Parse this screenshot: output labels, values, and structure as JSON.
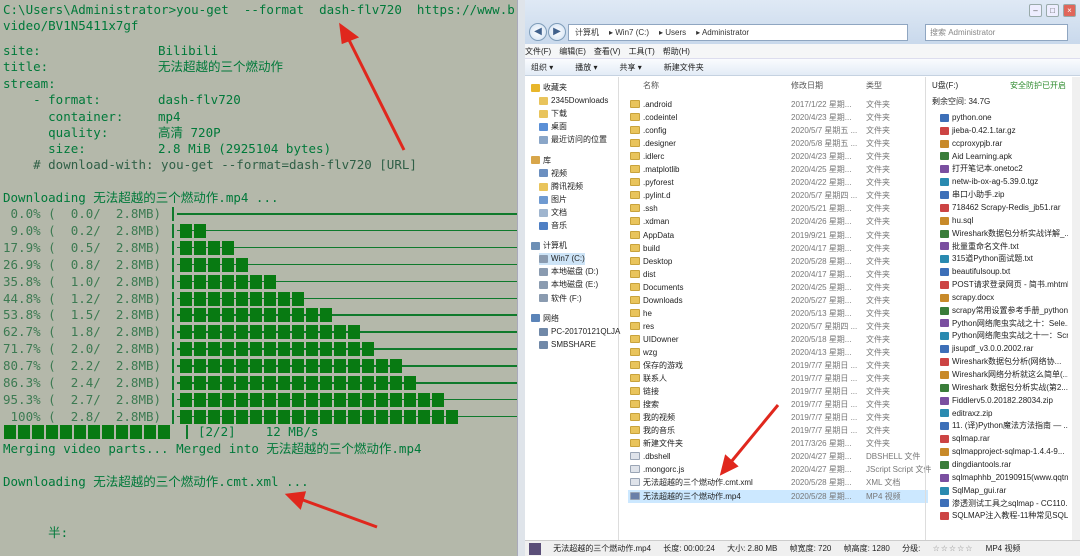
{
  "terminal": {
    "command_line_1": "C:\\Users\\Administrator>you-get  --format  dash-flv720  https://www.b",
    "command_line_2": "video/BV1N5411x7gf",
    "info": [
      {
        "label": "site:",
        "value": "Bilibili"
      },
      {
        "label": "title:",
        "value": "无法超越的三个燃动作"
      },
      {
        "label": "stream:",
        "value": ""
      }
    ],
    "stream": [
      {
        "label": "    - format:",
        "value": "dash-flv720"
      },
      {
        "label": "      container:",
        "value": "mp4"
      },
      {
        "label": "      quality:",
        "value": "高清 720P"
      },
      {
        "label": "      size:",
        "value": "2.8 MiB (2925104 bytes)"
      }
    ],
    "download_with": "    # download-with: you-get --format=dash-flv720 [URL]",
    "downloading_video": "Downloading 无法超越的三个燃动作.mp4 ...",
    "progress": [
      {
        "label": " 0.0% (  0.0/  2.8MB)",
        "fraction": 0.0
      },
      {
        "label": " 9.0% (  0.2/  2.8MB)",
        "fraction": 0.09
      },
      {
        "label": "17.9% (  0.5/  2.8MB)",
        "fraction": 0.179
      },
      {
        "label": "26.9% (  0.8/  2.8MB)",
        "fraction": 0.269
      },
      {
        "label": "35.8% (  1.0/  2.8MB)",
        "fraction": 0.358
      },
      {
        "label": "44.8% (  1.2/  2.8MB)",
        "fraction": 0.448
      },
      {
        "label": "53.8% (  1.5/  2.8MB)",
        "fraction": 0.538
      },
      {
        "label": "62.7% (  1.8/  2.8MB)",
        "fraction": 0.627
      },
      {
        "label": "71.7% (  2.0/  2.8MB)",
        "fraction": 0.717
      },
      {
        "label": "80.7% (  2.2/  2.8MB)",
        "fraction": 0.807
      },
      {
        "label": "86.3% (  2.4/  2.8MB)",
        "fraction": 0.863
      },
      {
        "label": "95.3% (  2.7/  2.8MB)",
        "fraction": 0.953
      },
      {
        "label": " 100% (  2.8/  2.8MB)",
        "fraction": 1.0
      }
    ],
    "final_bar_label": "[2/2]    12 MB/s",
    "merging": "Merging video parts... Merged into 无法超越的三个燃动作.mp4",
    "downloading_xml": "Downloading 无法超越的三个燃动作.cmt.xml ...",
    "trailing": "      半:"
  },
  "explorer": {
    "address": [
      "计算机",
      "Win7 (C:)",
      "Users",
      "Administrator"
    ],
    "search_placeholder": "搜索 Administrator",
    "menu": [
      "文件(F)",
      "编辑(E)",
      "查看(V)",
      "工具(T)",
      "帮助(H)"
    ],
    "toolbar": [
      "组织 ▾",
      "播放 ▾",
      "共享 ▾",
      "新建文件夹"
    ],
    "columns": {
      "name": "名称",
      "date": "修改日期",
      "type": "类型"
    },
    "nav": [
      {
        "label": "收藏夹",
        "icon": "star-icon",
        "color": "#e8b62b",
        "level": 0
      },
      {
        "label": "2345Downloads",
        "icon": "folder-icon",
        "color": "#e9c45c",
        "level": 1
      },
      {
        "label": "下载",
        "icon": "folder-icon",
        "color": "#e9c45c",
        "level": 1
      },
      {
        "label": "桌面",
        "icon": "desktop-icon",
        "color": "#5a8fd6",
        "level": 1
      },
      {
        "label": "最近访问的位置",
        "icon": "recent-icon",
        "color": "#8aa6c8",
        "level": 1
      },
      {
        "label": "库",
        "icon": "library-icon",
        "color": "#d8a64a",
        "level": 0
      },
      {
        "label": "视频",
        "icon": "video-icon",
        "color": "#6b8fc0",
        "level": 1
      },
      {
        "label": "腾讯视频",
        "icon": "folder-icon",
        "color": "#e9c45c",
        "level": 1
      },
      {
        "label": "图片",
        "icon": "picture-icon",
        "color": "#6f9ad1",
        "level": 1
      },
      {
        "label": "文档",
        "icon": "document-icon",
        "color": "#9fb5cf",
        "level": 1
      },
      {
        "label": "音乐",
        "icon": "music-icon",
        "color": "#4e7fc4",
        "level": 1
      },
      {
        "label": "计算机",
        "icon": "computer-icon",
        "color": "#6d8fb5",
        "level": 0
      },
      {
        "label": "Win7 (C:)",
        "icon": "drive-icon",
        "color": "#8a9bb0",
        "level": 1
      },
      {
        "label": "本地磁盘 (D:)",
        "icon": "drive-icon",
        "color": "#8a9bb0",
        "level": 1
      },
      {
        "label": "本地磁盘 (E:)",
        "icon": "drive-icon",
        "color": "#8a9bb0",
        "level": 1
      },
      {
        "label": "软件 (F:)",
        "icon": "drive-icon",
        "color": "#8a9bb0",
        "level": 1
      },
      {
        "label": "网络",
        "icon": "network-icon",
        "color": "#5b84b8",
        "level": 0
      },
      {
        "label": "PC-20170121QLJA",
        "icon": "pc-icon",
        "color": "#7088a8",
        "level": 1
      },
      {
        "label": "SMBSHARE",
        "icon": "pc-icon",
        "color": "#7088a8",
        "level": 1
      }
    ],
    "files": [
      {
        "name": ".android",
        "date": "2017/1/22 星期...",
        "type": "文件夹",
        "icon": "folder-icon"
      },
      {
        "name": ".codeintel",
        "date": "2020/4/23 星期...",
        "type": "文件夹",
        "icon": "folder-icon"
      },
      {
        "name": ".config",
        "date": "2020/5/7 星期五 ...",
        "type": "文件夹",
        "icon": "folder-icon"
      },
      {
        "name": ".designer",
        "date": "2020/5/8 星期五 ...",
        "type": "文件夹",
        "icon": "folder-icon"
      },
      {
        "name": ".idlerc",
        "date": "2020/4/23 星期...",
        "type": "文件夹",
        "icon": "folder-icon"
      },
      {
        "name": ".matplotlib",
        "date": "2020/4/25 星期...",
        "type": "文件夹",
        "icon": "folder-icon"
      },
      {
        "name": ".pyforest",
        "date": "2020/4/22 星期...",
        "type": "文件夹",
        "icon": "folder-icon"
      },
      {
        "name": ".pylint.d",
        "date": "2020/5/7 星期四 ...",
        "type": "文件夹",
        "icon": "folder-icon"
      },
      {
        "name": ".ssh",
        "date": "2020/5/21 星期...",
        "type": "文件夹",
        "icon": "folder-icon"
      },
      {
        "name": ".xdman",
        "date": "2020/4/26 星期...",
        "type": "文件夹",
        "icon": "folder-icon"
      },
      {
        "name": "AppData",
        "date": "2019/9/21 星期...",
        "type": "文件夹",
        "icon": "folder-icon"
      },
      {
        "name": "build",
        "date": "2020/4/17 星期...",
        "type": "文件夹",
        "icon": "folder-icon"
      },
      {
        "name": "Desktop",
        "date": "2020/5/28 星期...",
        "type": "文件夹",
        "icon": "folder-icon"
      },
      {
        "name": "dist",
        "date": "2020/4/17 星期...",
        "type": "文件夹",
        "icon": "folder-icon"
      },
      {
        "name": "Documents",
        "date": "2020/4/25 星期...",
        "type": "文件夹",
        "icon": "folder-icon"
      },
      {
        "name": "Downloads",
        "date": "2020/5/27 星期...",
        "type": "文件夹",
        "icon": "folder-icon"
      },
      {
        "name": "he",
        "date": "2020/5/13 星期...",
        "type": "文件夹",
        "icon": "folder-icon"
      },
      {
        "name": "res",
        "date": "2020/5/7 星期四 ...",
        "type": "文件夹",
        "icon": "folder-icon"
      },
      {
        "name": "UIDowner",
        "date": "2020/5/18 星期...",
        "type": "文件夹",
        "icon": "folder-icon"
      },
      {
        "name": "wzg",
        "date": "2020/4/13 星期...",
        "type": "文件夹",
        "icon": "folder-icon"
      },
      {
        "name": "保存的游戏",
        "date": "2019/7/7 星期日 ...",
        "type": "文件夹",
        "icon": "folder-icon"
      },
      {
        "name": "联系人",
        "date": "2019/7/7 星期日 ...",
        "type": "文件夹",
        "icon": "folder-icon"
      },
      {
        "name": "链接",
        "date": "2019/7/7 星期日 ...",
        "type": "文件夹",
        "icon": "folder-icon"
      },
      {
        "name": "搜索",
        "date": "2019/7/7 星期日 ...",
        "type": "文件夹",
        "icon": "folder-icon"
      },
      {
        "name": "我的视频",
        "date": "2019/7/7 星期日 ...",
        "type": "文件夹",
        "icon": "folder-icon"
      },
      {
        "name": "我的音乐",
        "date": "2019/7/7 星期日 ...",
        "type": "文件夹",
        "icon": "folder-icon"
      },
      {
        "name": "新建文件夹",
        "date": "2017/3/26 星期...",
        "type": "文件夹",
        "icon": "folder-icon"
      },
      {
        "name": ".dbshell",
        "date": "2020/4/27 星期...",
        "type": "DBSHELL 文件",
        "icon": "file-icon"
      },
      {
        "name": ".mongorc.js",
        "date": "2020/4/27 星期...",
        "type": "JScript Script 文件",
        "icon": "script-icon"
      },
      {
        "name": "无法超越的三个燃动作.cmt.xml",
        "date": "2020/5/28 星期...",
        "type": "XML 文档",
        "icon": "xml-icon"
      },
      {
        "name": "无法超越的三个燃动作.mp4",
        "date": "2020/5/28 星期...",
        "type": "MP4 视频",
        "icon": "video-file-icon",
        "selected": true
      }
    ],
    "usb": {
      "title": "U盘(F:)",
      "safe_remove": "安全防护已开启",
      "free_space": "剩余空间: 34.7G",
      "files": [
        "python.one",
        "jieba-0.42.1.tar.gz",
        "ccproxypjb.rar",
        "Aid Learning.apk",
        "打开笔记本.onetoc2",
        "netw-ib-ox-ag-5.39.0.tgz",
        "串口小助手.zip",
        "718462 Scrapy-Redis_jb51.rar",
        "hu.sql",
        "Wireshark数据包分析实战详解_...",
        "批量重命名文件.txt",
        "315道Python面试题.txt",
        "beautifulsoup.txt",
        "POST请求登录网页 - 简书.mhtml",
        "scrapy.docx",
        "scrapy常用设置参考手册_python...",
        "Python网络爬虫实战之十：Sele...",
        "Python网络爬虫实战之十一：Scr...",
        "jisupdf_v3.0.0.2002.rar",
        "Wireshark数据包分析(网络协...",
        "Wireshark网络分析就这么简单(...",
        "Wireshark 数据包分析实战(第2...",
        "Fiddlerv5.0.20182.28034.zip",
        "editraxz.zip",
        "11. (译)Python魔法方法指南 — ...",
        "sqlmap.rar",
        "sqlmapproject-sqlmap-1.4.4-9...",
        "dingdiantools.rar",
        "sqlmaphhb_20190915(www.qqtn...",
        "SqlMap_gui.rar",
        "渗透测试工具之sqlmap - CC110...",
        "SQLMAP注入教程-11种常见SQL..."
      ]
    },
    "status": {
      "filename": "无法超越的三个燃动作.mp4",
      "length": "长度: 00:00:24",
      "size": "大小: 2.80 MB",
      "frame_width_label": "帧宽度: 720",
      "frame_height_label": "帧高度: 1280",
      "rating_label": "分级:",
      "rating_stars": "☆☆☆☆☆",
      "type": "MP4 视频"
    }
  },
  "colors": {
    "terminal_bg": "#b4b8aa",
    "terminal_text": "#00793a",
    "arrow": "#e0271d",
    "folder": "#e9c45c"
  }
}
